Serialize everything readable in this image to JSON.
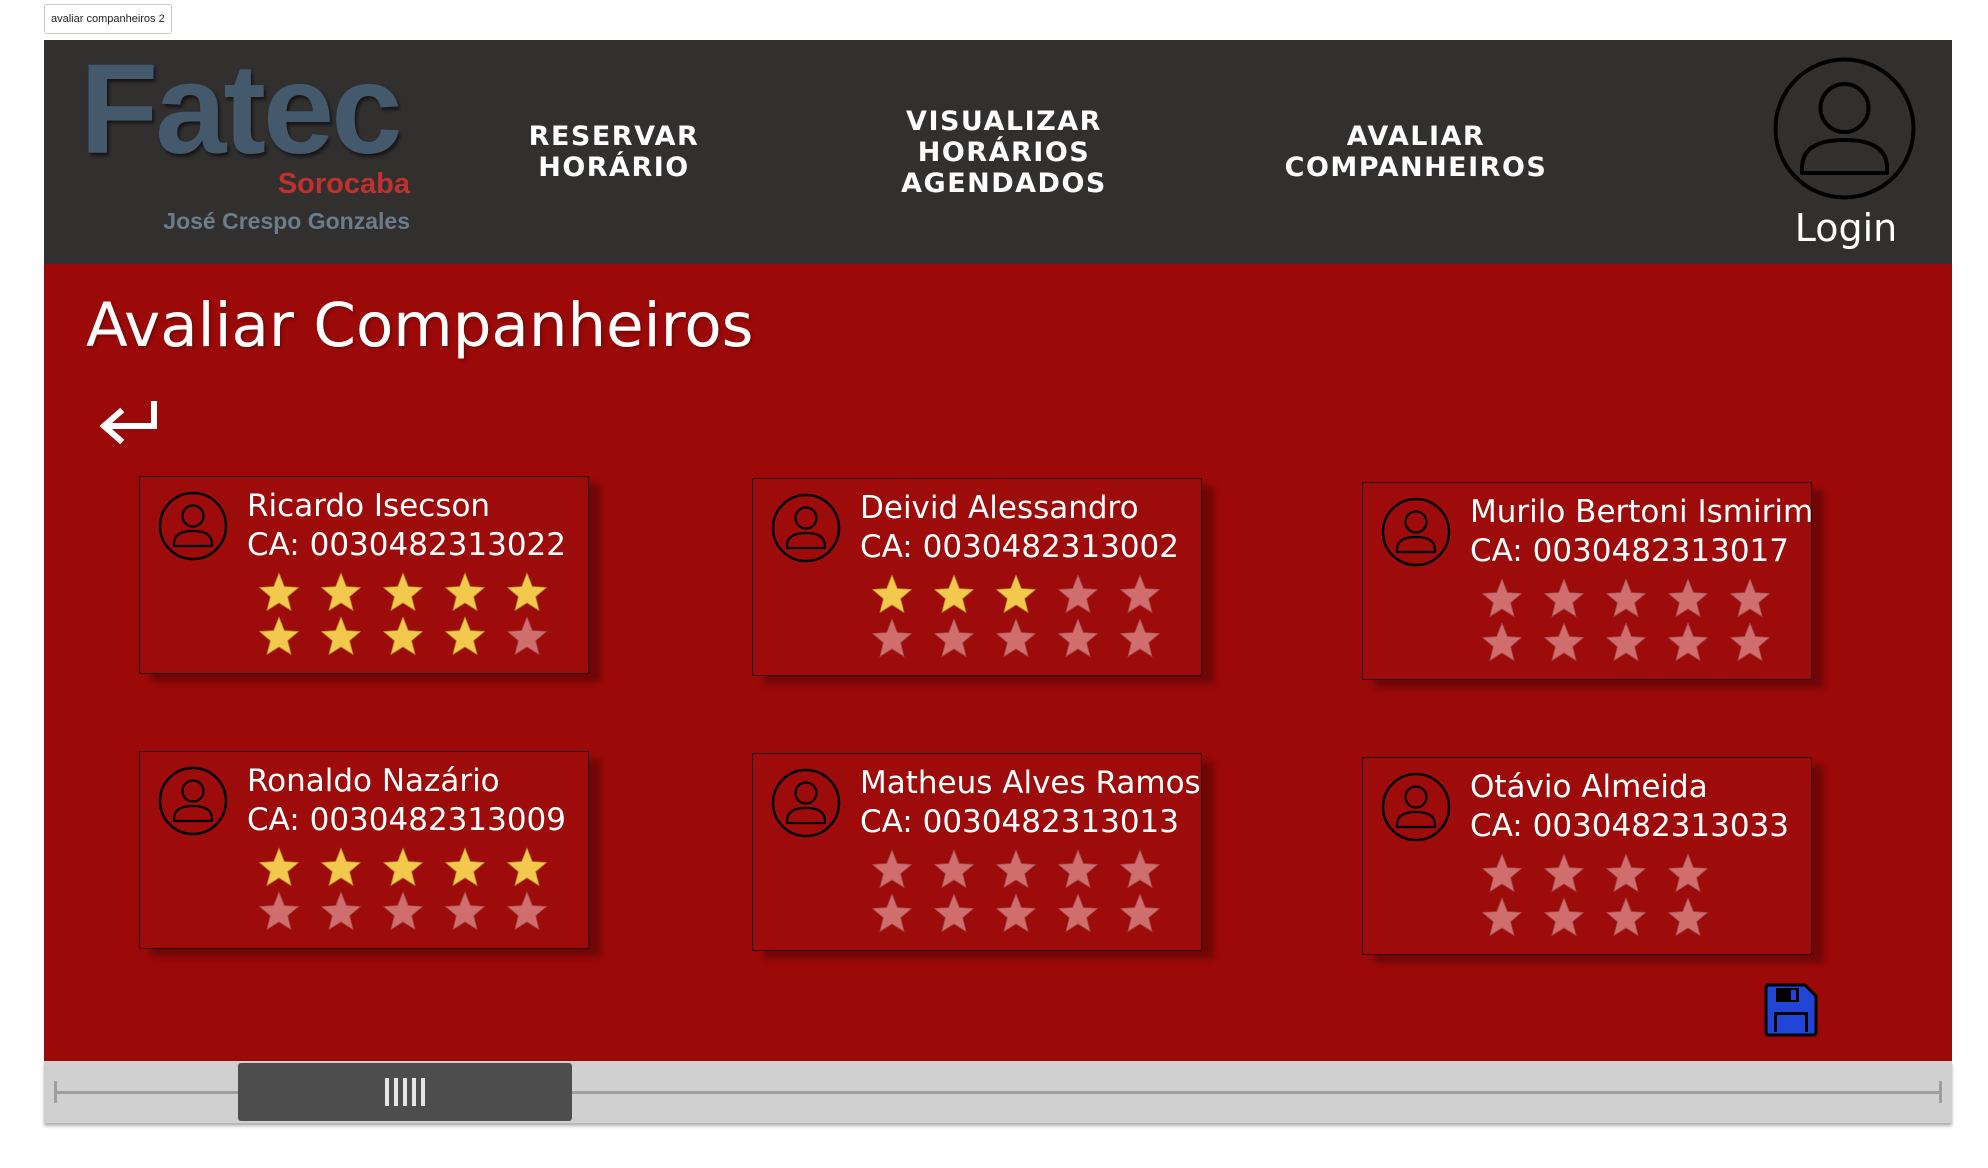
{
  "frame_label": "avaliar companheiros 2",
  "logo": {
    "name": "Fatec",
    "city": "Sorocaba",
    "person": "José Crespo Gonzales"
  },
  "nav": [
    {
      "lines": [
        "RESERVAR",
        "HORÁRIO"
      ]
    },
    {
      "lines": [
        "VISUALIZAR",
        "HORÁRIOS",
        "AGENDADOS"
      ]
    },
    {
      "lines": [
        "AVALIAR",
        "COMPANHEIROS"
      ]
    }
  ],
  "login": {
    "label": "Login",
    "icon": "user-icon"
  },
  "page": {
    "title": "Avaliar Companheiros",
    "back_icon": "return-arrow-icon"
  },
  "peers": [
    {
      "name": "Ricardo Isecson",
      "ca": "CA: 0030482313022",
      "rating": 9,
      "stars_shown": 10
    },
    {
      "name": "Deivid Alessandro",
      "ca": "CA: 0030482313002",
      "rating": 3,
      "stars_shown": 10
    },
    {
      "name": "Murilo Bertoni Ismirim",
      "ca": "CA: 0030482313017",
      "rating": 0,
      "stars_shown": 10
    },
    {
      "name": "Ronaldo Nazário",
      "ca": "CA: 0030482313009",
      "rating": 5,
      "stars_shown": 10
    },
    {
      "name": "Matheus Alves Ramos",
      "ca": "CA: 0030482313013",
      "rating": 0,
      "stars_shown": 10
    },
    {
      "name": "Otávio Almeida",
      "ca": "CA: 0030482313033",
      "rating": 0,
      "stars_shown": 8
    }
  ],
  "save": {
    "icon": "floppy-disk-icon"
  },
  "scrollbar": {
    "position": 0.1
  },
  "colors": {
    "header_bg": "#322f2f",
    "main_bg": "#9c0909",
    "star_filled": "#f2c94c",
    "star_empty": "#d06e6e",
    "save_icon": "#2145d6",
    "logo_fatec": "#44596c",
    "logo_city": "#c0312e"
  }
}
